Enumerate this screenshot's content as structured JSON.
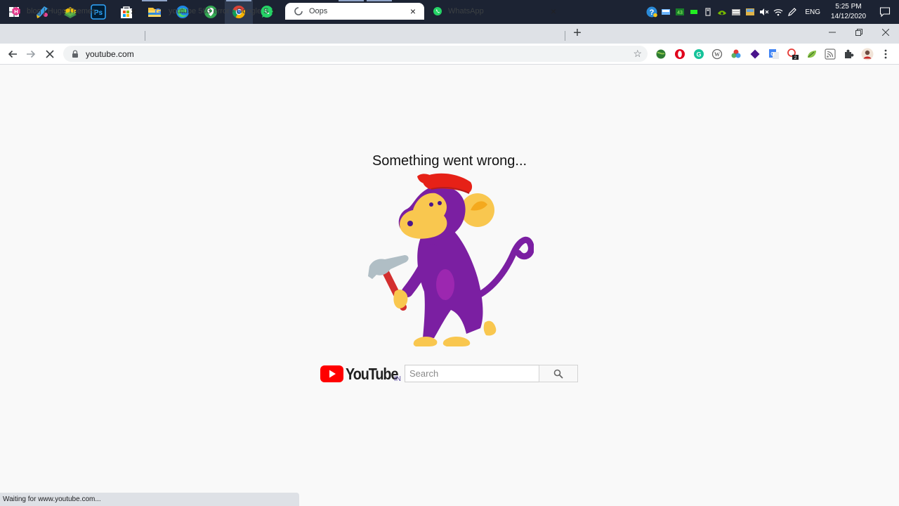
{
  "taskbar": {
    "apps": [
      {
        "icon": "windows-start-icon"
      },
      {
        "icon": "paint-app-icon"
      },
      {
        "icon": "bluestacks-icon"
      },
      {
        "icon": "photoshop-icon",
        "label": "Ps"
      },
      {
        "icon": "store-icon"
      },
      {
        "icon": "file-explorer-icon"
      },
      {
        "icon": "edge-icon"
      },
      {
        "icon": "maps-icon"
      },
      {
        "icon": "chrome-icon"
      },
      {
        "icon": "whatsapp-icon"
      },
      {
        "icon": "opera-icon"
      },
      {
        "icon": "sticky-notes-icon"
      },
      {
        "icon": "camera-app-icon"
      },
      {
        "icon": "window-app-icon"
      },
      {
        "icon": "vscode-icon"
      }
    ],
    "tray": {
      "language": "ENG",
      "time": "5:25 PM",
      "date": "14/12/2020"
    }
  },
  "browser": {
    "tabs": [
      {
        "title": "blog | Hugo Themes",
        "favicon": "hugo-icon",
        "active": false
      },
      {
        "title": "youtube 503 error - Google Search",
        "favicon": "google-icon",
        "active": false
      },
      {
        "title": "Oops",
        "favicon": "loading-spinner-icon",
        "active": true
      },
      {
        "title": "WhatsApp",
        "favicon": "whatsapp-icon",
        "active": false
      }
    ],
    "new_tab_label": "+",
    "address": "youtube.com",
    "status_text": "Waiting for www.youtube.com..."
  },
  "page": {
    "headline": "Something went wrong...",
    "logo_text": "YouTube",
    "logo_country": "IN",
    "search_placeholder": "Search"
  },
  "colors": {
    "youtube_red": "#ff0000",
    "monkey_purple": "#7b1fa2",
    "monkey_yellow": "#f9c74f",
    "hat_red": "#e62117",
    "taskbar_bg": "#1c2333"
  }
}
